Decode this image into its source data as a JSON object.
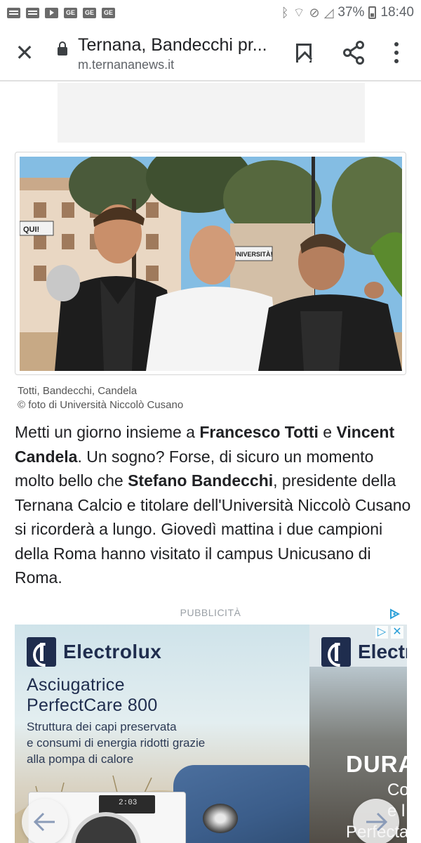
{
  "status_bar": {
    "left_icons": [
      "news-icon",
      "news-icon",
      "youtube-icon",
      "ge-icon",
      "ge-icon",
      "ge-icon"
    ],
    "ge_label": "GE",
    "battery": "37%",
    "time": "18:40"
  },
  "toolbar": {
    "title": "Ternana, Bandecchi pr...",
    "url": "m.ternananews.it"
  },
  "photo": {
    "sign_left": "QUI!",
    "sign_right": "UNIVERSITÀ!"
  },
  "caption": {
    "line1": "Totti, Bandecchi, Candela",
    "line2": "© foto di Università Niccolò Cusano"
  },
  "article": {
    "p1": "Metti un giorno insieme a ",
    "b1": "Francesco Totti",
    "p2": " e ",
    "b2": "Vincent Candela",
    "p3": ". Un sogno? Forse, di sicuro un momento molto bello che ",
    "b3": "Stefano Bandecchi",
    "p4": ", presidente della Ternana Calcio e titolare dell'Università Niccolò Cusano si ricorderà a lungo. Giovedì mattina i due campioni della Roma hanno visitato il campus Unicusano di Roma."
  },
  "ad": {
    "label": "PUBBLICITÀ",
    "brand": "Electrolux",
    "headline_1": "Asciugatrice",
    "headline_2": "PerfectCare 800",
    "body_1": "Struttura dei capi preservata",
    "body_2": "e consumi di energia ridotti grazie",
    "body_3": "alla pompa di calore",
    "side_brand": "Electr",
    "side_text_1": "DURA",
    "side_text_2": "Co",
    "side_text_3": "e l",
    "side_text_4": "Perfecta",
    "washer_display": "2:03"
  }
}
